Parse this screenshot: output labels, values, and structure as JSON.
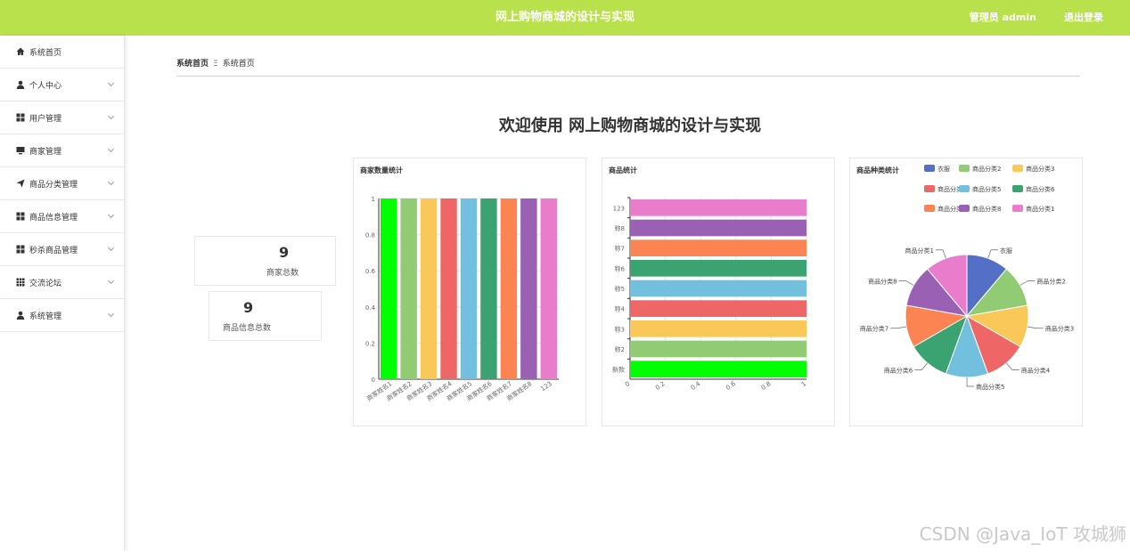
{
  "header": {
    "title": "网上购物商城的设计与实现",
    "user": "管理员 admin",
    "logout": "退出登录"
  },
  "sidebar": {
    "items": [
      {
        "label": "系统首页",
        "icon": "home-icon",
        "expandable": false
      },
      {
        "label": "个人中心",
        "icon": "user-icon",
        "expandable": true
      },
      {
        "label": "用户管理",
        "icon": "grid-icon",
        "expandable": true
      },
      {
        "label": "商家管理",
        "icon": "monitor-icon",
        "expandable": true
      },
      {
        "label": "商品分类管理",
        "icon": "paper-plane-icon",
        "expandable": true
      },
      {
        "label": "商品信息管理",
        "icon": "grid-icon",
        "expandable": true
      },
      {
        "label": "秒杀商品管理",
        "icon": "grid-icon",
        "expandable": true
      },
      {
        "label": "交流论坛",
        "icon": "apps-icon",
        "expandable": true
      },
      {
        "label": "系统管理",
        "icon": "user-icon",
        "expandable": true
      }
    ]
  },
  "breadcrumb": {
    "root": "系统首页",
    "separator": "Ξ",
    "current": "系统首页"
  },
  "welcome": "欢迎使用 网上购物商城的设计与实现",
  "stats": [
    {
      "value": "9",
      "label": "商家总数"
    },
    {
      "value": "9",
      "label": "商品信息总数"
    }
  ],
  "watermark": "CSDN @Java_IoT 攻城狮",
  "chart_data": [
    {
      "type": "bar",
      "title": "商家数量统计",
      "categories": [
        "商家姓名1",
        "商家姓名2",
        "商家姓名3",
        "商家姓名4",
        "商家姓名5",
        "商家姓名6",
        "商家姓名7",
        "商家姓名8",
        "123"
      ],
      "values": [
        1,
        1,
        1,
        1,
        1,
        1,
        1,
        1,
        1
      ],
      "colors": [
        "#00ff00",
        "#91cc75",
        "#fac858",
        "#ee6666",
        "#73c0de",
        "#3ba272",
        "#fc8452",
        "#9a60b4",
        "#ea7ccc"
      ],
      "ylim": [
        0,
        1
      ],
      "yticks": [
        "0",
        "0.2",
        "0.4",
        "0.6",
        "0.8",
        "1"
      ],
      "grid": true
    },
    {
      "type": "bar",
      "orientation": "horizontal",
      "title": "商品统计",
      "categories": [
        "新款",
        "称2",
        "称3",
        "称4",
        "称5",
        "称6",
        "称7",
        "称8",
        "123"
      ],
      "values": [
        1,
        1,
        1,
        1,
        1,
        1,
        1,
        1,
        1
      ],
      "colors": [
        "#00ff00",
        "#91cc75",
        "#fac858",
        "#ee6666",
        "#73c0de",
        "#3ba272",
        "#fc8452",
        "#9a60b4",
        "#ea7ccc"
      ],
      "xlim": [
        0,
        1
      ],
      "xticks": [
        "0",
        "0.2",
        "0.4",
        "0.6",
        "0.8",
        "1"
      ],
      "grid": true
    },
    {
      "type": "pie",
      "title": "商品种类统计",
      "categories": [
        "衣服",
        "商品分类2",
        "商品分类3",
        "商品分类4",
        "商品分类5",
        "商品分类6",
        "商品分类7",
        "商品分类8",
        "商品分类1"
      ],
      "values": [
        1,
        1,
        1,
        1,
        1,
        1,
        1,
        1,
        1
      ],
      "colors": [
        "#5470c6",
        "#91cc75",
        "#fac858",
        "#ee6666",
        "#73c0de",
        "#3ba272",
        "#fc8452",
        "#9a60b4",
        "#ea7ccc"
      ],
      "legend": "top-right"
    }
  ]
}
